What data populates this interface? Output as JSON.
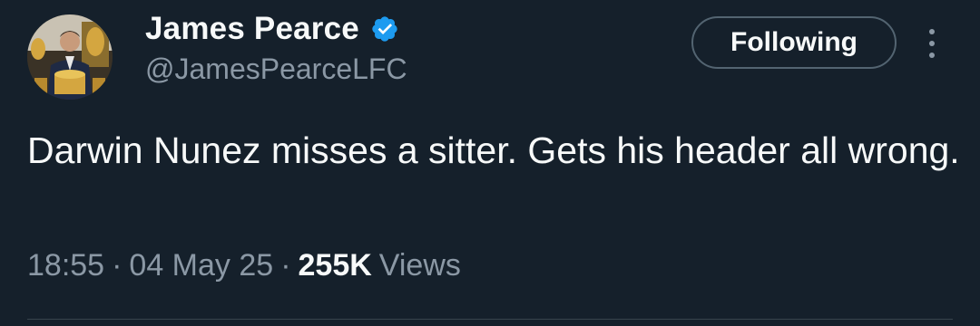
{
  "author": {
    "display_name": "James Pearce",
    "handle": "@JamesPearceLFC",
    "verified": true
  },
  "follow_button": {
    "label": "Following"
  },
  "more_menu": {
    "icon": "more-vertical-icon"
  },
  "tweet": {
    "text": "Darwin Nunez misses a sitter. Gets his header all wrong."
  },
  "meta": {
    "time": "18:55",
    "separator": "·",
    "date": "04 May 25",
    "views_count": "255K",
    "views_label": "Views"
  },
  "colors": {
    "background": "#15202b",
    "primary_text": "#f7f9f9",
    "secondary_text": "#8b98a5",
    "verified_badge": "#1d9bf0",
    "button_border": "#536471"
  }
}
